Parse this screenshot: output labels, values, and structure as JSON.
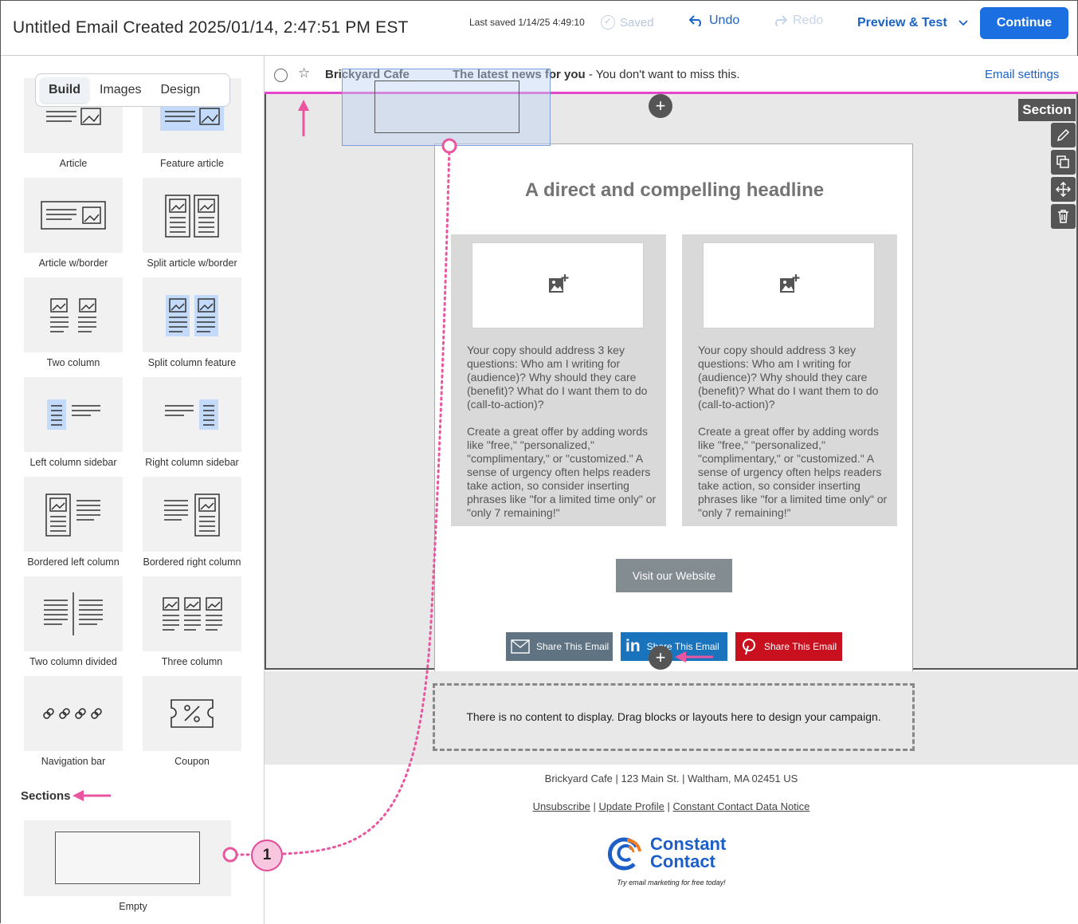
{
  "header": {
    "title": "Untitled Email Created 2025/01/14, 2:47:51 PM EST",
    "last_saved": "Last saved 1/14/25 4:49:10",
    "saved_label": "Saved",
    "undo_label": "Undo",
    "redo_label": "Redo",
    "preview_label": "Preview & Test",
    "continue_label": "Continue"
  },
  "tabs": [
    {
      "label": "Build",
      "active": true
    },
    {
      "label": "Images",
      "active": false
    },
    {
      "label": "Design",
      "active": false
    }
  ],
  "layouts": [
    {
      "label": "Article",
      "icon": "article-icon"
    },
    {
      "label": "Feature article",
      "icon": "feature-article-icon"
    },
    {
      "label": "Article w/border",
      "icon": "article-border-icon"
    },
    {
      "label": "Split article w/border",
      "icon": "split-article-border-icon"
    },
    {
      "label": "Two column",
      "icon": "two-column-icon"
    },
    {
      "label": "Split column feature",
      "icon": "split-column-feature-icon"
    },
    {
      "label": "Left column sidebar",
      "icon": "left-column-sidebar-icon"
    },
    {
      "label": "Right column sidebar",
      "icon": "right-column-sidebar-icon"
    },
    {
      "label": "Bordered left column",
      "icon": "bordered-left-column-icon"
    },
    {
      "label": "Bordered right column",
      "icon": "bordered-right-column-icon"
    },
    {
      "label": "Two column divided",
      "icon": "two-column-divided-icon"
    },
    {
      "label": "Three column",
      "icon": "three-column-icon"
    },
    {
      "label": "Navigation bar",
      "icon": "link-icon"
    },
    {
      "label": "Coupon",
      "icon": "coupon-icon"
    }
  ],
  "sections": {
    "heading": "Sections",
    "empty_label": "Empty"
  },
  "email": {
    "from": "Brickyard Cafe",
    "subject_bold": "The latest news for you",
    "subject_rest": " - You don't want to miss this.",
    "settings_label": "Email settings",
    "headline": "A direct and compelling headline",
    "copy_p1": "Your copy should address 3 key questions: Who am I writing for (audience)? Why should they care (benefit)? What do I want them to do (call-to-action)?",
    "copy_p2": "Create a great offer by adding words like \"free,\" \"personalized,\" \"complimentary,\" or \"customized.\" A sense of urgency often helps readers take action, so consider inserting phrases like \"for a limited time only\" or \"only 7 remaining!\"",
    "button_label": "Visit our Website",
    "share_buttons": [
      {
        "label": "Share This Email",
        "network": "email",
        "color": "#5f7382"
      },
      {
        "label": "Share This Email",
        "network": "linkedin",
        "color": "#1a73bd"
      },
      {
        "label": "Share This Email",
        "network": "pinterest",
        "color": "#c8101f"
      }
    ],
    "section_tag": "Section",
    "dropzone_text": "There is no content to display. Drag blocks or layouts here to design your campaign.",
    "footer_address": "Brickyard Cafe | 123 Main St. | Waltham, MA 02451 US",
    "footer_links": [
      "Unsubscribe",
      "Update Profile",
      "Constant Contact Data Notice"
    ],
    "logo_word1": "Constant",
    "logo_word2": "Contact",
    "logo_tagline": "Try email marketing for free today!"
  },
  "annotation": {
    "step_number": "1",
    "color": "#e9569f"
  },
  "colors": {
    "accent": "#1b6fe0",
    "highlight_line": "#e347c9",
    "canvas_bg": "#e8e8e8"
  }
}
